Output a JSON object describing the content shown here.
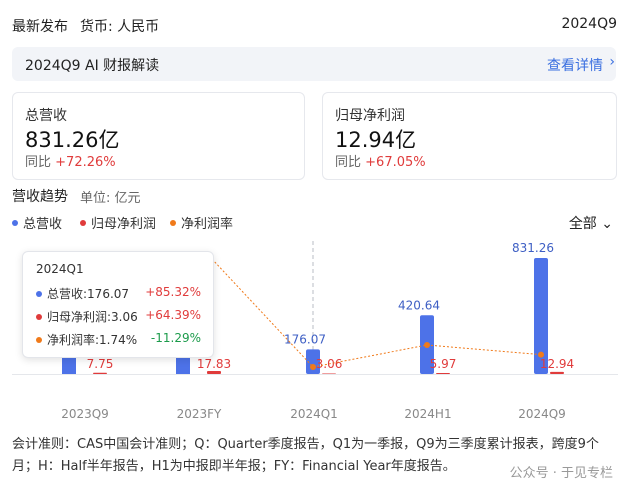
{
  "header": {
    "title": "最新发布",
    "currency": "货币: 人民币",
    "period": "2024Q9"
  },
  "ai": {
    "title": "2024Q9 AI 财报解读",
    "link": "查看详情"
  },
  "cards": [
    {
      "label": "总营收",
      "value": "831.26亿",
      "yoy_label": "同比",
      "yoy": "+72.26%"
    },
    {
      "label": "归母净利润",
      "value": "12.94亿",
      "yoy_label": "同比",
      "yoy": "+67.05%"
    }
  ],
  "trend": {
    "title": "营收趋势",
    "unit": "单位: 亿元",
    "legend": [
      "总营收",
      "归母净利润",
      "净利润率"
    ],
    "dropdown": "全部"
  },
  "colors": {
    "revenue": "#4d72e8",
    "profit": "#e03b3b",
    "margin": "#f07a1a",
    "link": "#3a6fe0"
  },
  "tooltip": {
    "period": "2024Q1",
    "rows": [
      {
        "label": "总营收:176.07",
        "pct": "+85.32%"
      },
      {
        "label": "归母净利润:3.06",
        "pct": "+64.39%"
      },
      {
        "label": "净利润率:1.74%",
        "pct": "-11.29%"
      }
    ]
  },
  "chart_data": {
    "type": "bar",
    "categories": [
      "2023Q9",
      "2023FY",
      "2024Q1",
      "2024H1",
      "2024Q9"
    ],
    "series": [
      {
        "name": "总营收",
        "values": [
          null,
          null,
          176.07,
          420.64,
          831.26
        ],
        "labels": [
          "",
          "",
          "176.07",
          "420.64",
          "831.26"
        ]
      },
      {
        "name": "归母净利润",
        "values": [
          7.75,
          17.83,
          3.06,
          5.97,
          12.94
        ],
        "labels": [
          "7.75",
          "17.83",
          "3.06",
          "5.97",
          "12.94"
        ]
      },
      {
        "name": "净利润率",
        "type": "line",
        "values": [
          null,
          null,
          1.74,
          1.42,
          1.56
        ]
      }
    ]
  },
  "note": "会计准则：CAS中国会计准则；Q：Quarter季度报告，Q1为一季报，Q9为三季度累计报表，跨度9个月；H：Half半年报告，H1为中报即半年报；FY：Financial Year年度报告。",
  "watermark": "公众号 · 于见专栏"
}
